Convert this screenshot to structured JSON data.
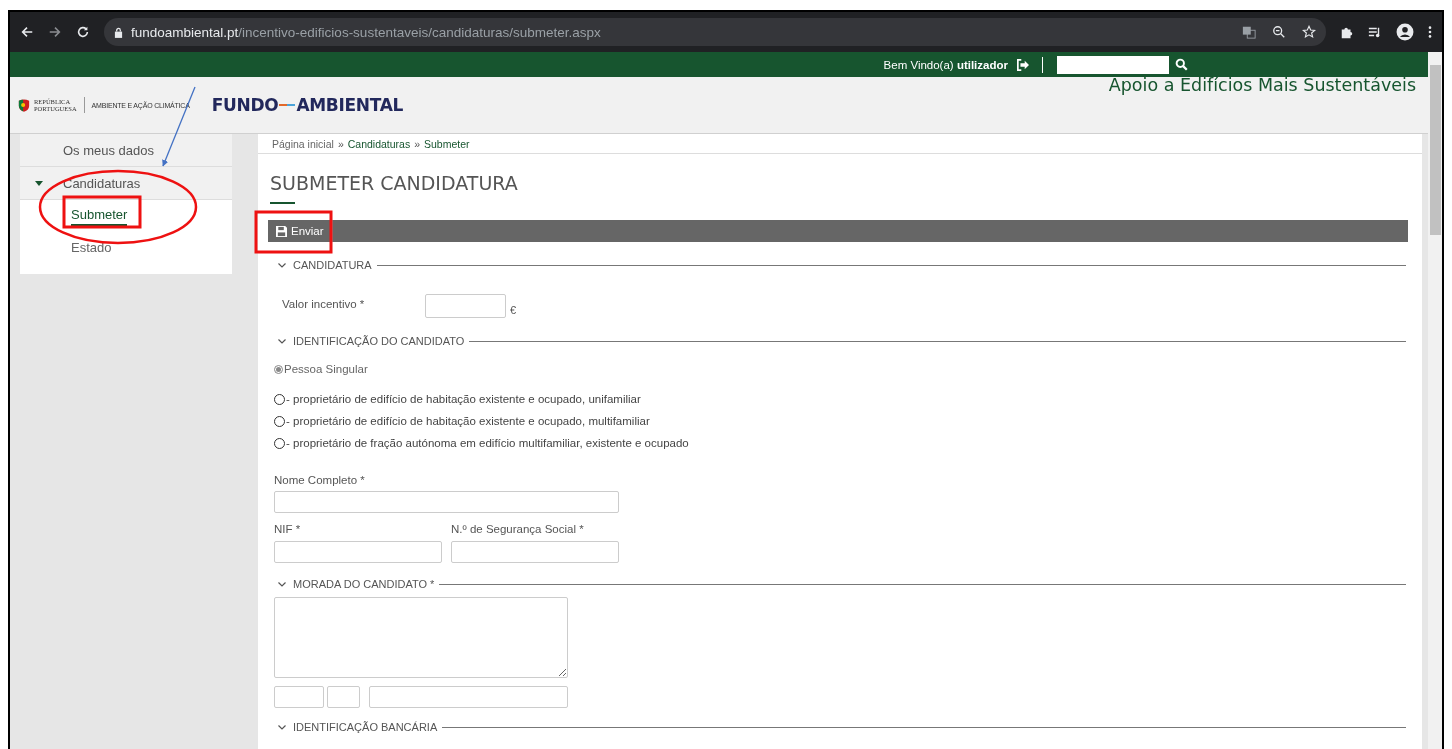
{
  "browser": {
    "url_host": "fundoambiental.pt",
    "url_path": "/incentivo-edificios-sustentaveis/candidaturas/submeter.aspx"
  },
  "topbar": {
    "welcome": "Bem Vindo(a)",
    "user": "utilizador"
  },
  "header": {
    "gov_lines": [
      "REPÚBLICA",
      "PORTUGUESA"
    ],
    "ministry": "AMBIENTE E AÇÃO CLIMÁTICA",
    "brand": [
      "FUNDO",
      "AMBIENTAL"
    ],
    "site_title": "Apoio a Edifícios Mais Sustentáveis"
  },
  "sidebar": {
    "items": [
      {
        "label": "Os meus dados"
      },
      {
        "label": "Candidaturas",
        "expanded": true,
        "children": [
          {
            "label": "Submeter",
            "selected": true
          },
          {
            "label": "Estado",
            "selected": false
          }
        ]
      }
    ]
  },
  "breadcrumb": {
    "separator": "»",
    "items": [
      "Página inicial",
      "Candidaturas",
      "Submeter"
    ]
  },
  "page_title": "SUBMETER CANDIDATURA",
  "toolbar": {
    "buttons": [
      "Enviar"
    ]
  },
  "sections": {
    "candidatura": "CANDIDATURA",
    "identificacao": "IDENTIFICAÇÃO DO CANDIDATO",
    "morada": "MORADA DO CANDIDATO *",
    "bancaria": "IDENTIFICAÇÃO BANCÁRIA"
  },
  "valor": {
    "label": "Valor incentivo *",
    "unit": "€"
  },
  "person_type": {
    "label": "Pessoa Singular",
    "selected": true,
    "disabled": true
  },
  "owner_options": [
    {
      "label": "- proprietário de edifício de habitação existente e ocupado, unifamiliar",
      "selected": false
    },
    {
      "label": "- proprietário de edifício de habitação existente e ocupado, multifamiliar",
      "selected": false
    },
    {
      "label": "- proprietário de fração autónoma em edifício multifamiliar, existente e ocupado",
      "selected": false
    }
  ],
  "fields": {
    "nome": "Nome Completo *",
    "nif": "NIF *",
    "nss": "N.º de Segurança Social *"
  }
}
